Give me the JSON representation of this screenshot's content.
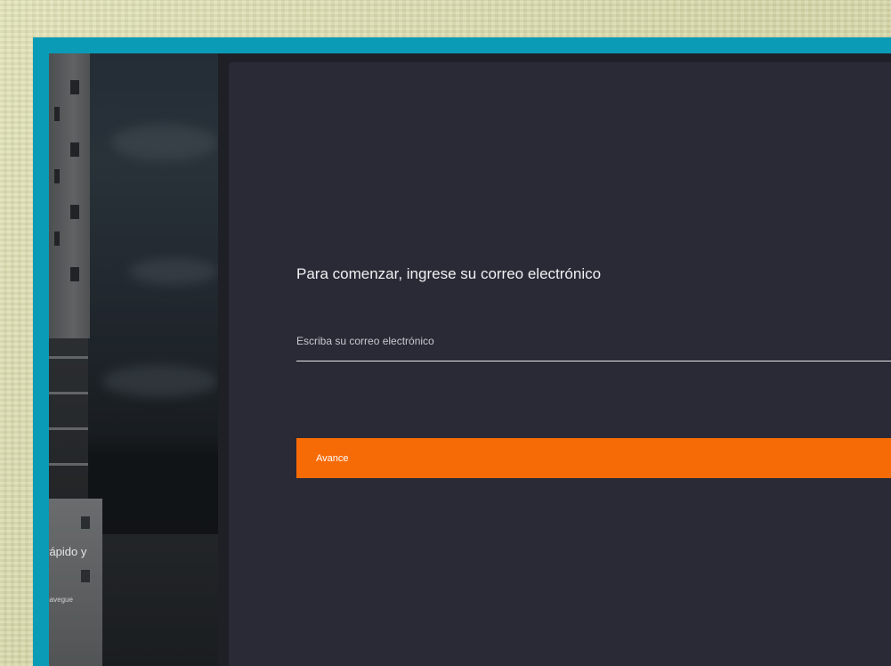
{
  "left_panel": {
    "promo_title": "s rápido y",
    "promo_subtitle": "y navegue"
  },
  "form": {
    "heading": "Para comenzar, ingrese su correo electrónico",
    "email_placeholder": "Escriba su correo electrónico",
    "email_value": "",
    "submit_label": "Avance"
  },
  "colors": {
    "accent": "#f76b07",
    "frame": "#0a9bb6",
    "card_background": "#292a35"
  }
}
